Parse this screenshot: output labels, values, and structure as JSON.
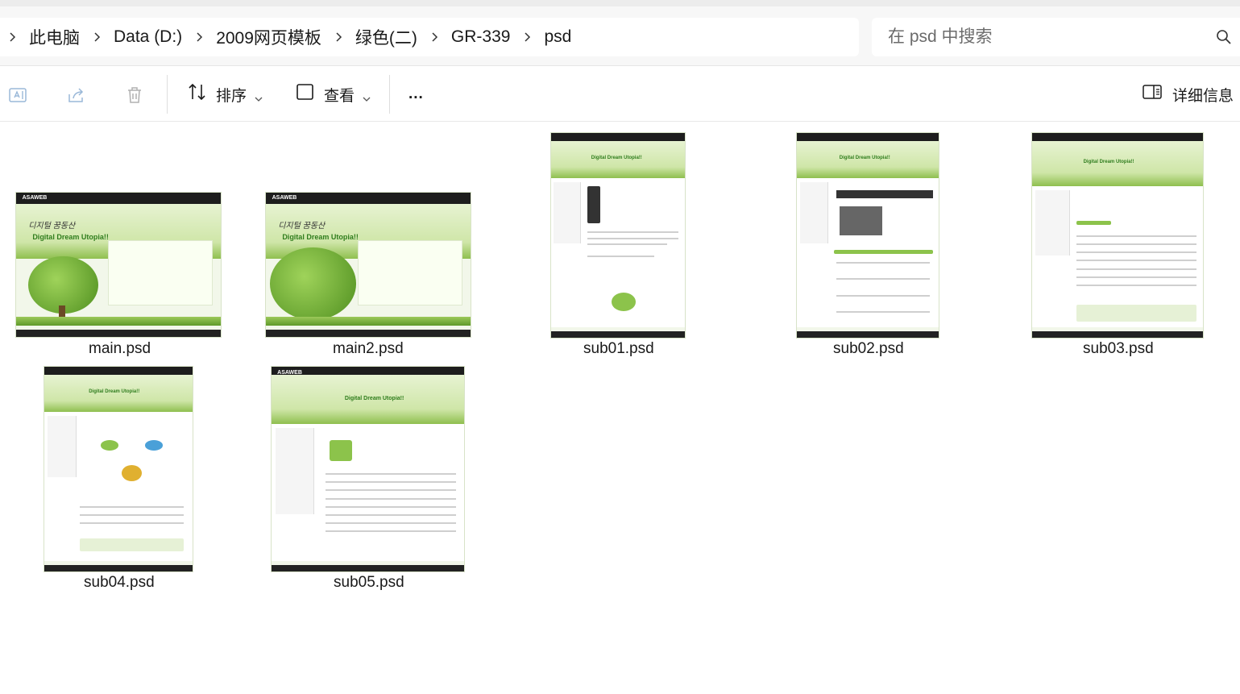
{
  "breadcrumb": {
    "items": [
      "此电脑",
      "Data (D:)",
      "2009网页模板",
      "绿色(二)",
      "GR-339",
      "psd"
    ]
  },
  "search": {
    "placeholder": "在 psd 中搜索"
  },
  "toolbar": {
    "sort_label": "排序",
    "view_label": "查看",
    "more_label": "...",
    "details_label": "详细信息"
  },
  "thumbnail_text": {
    "logo": "ASAWEB",
    "hero_title": "Digital Dream Utopia!!",
    "hero_script": "디지털 꿈동산"
  },
  "files": [
    {
      "name": "main.psd"
    },
    {
      "name": "main2.psd"
    },
    {
      "name": "sub01.psd"
    },
    {
      "name": "sub02.psd"
    },
    {
      "name": "sub03.psd"
    },
    {
      "name": "sub04.psd"
    },
    {
      "name": "sub05.psd"
    }
  ],
  "colors": {
    "accent_green": "#8cc34b",
    "dark_green": "#2f7d1d",
    "nav_dark": "#1d1d1d"
  }
}
